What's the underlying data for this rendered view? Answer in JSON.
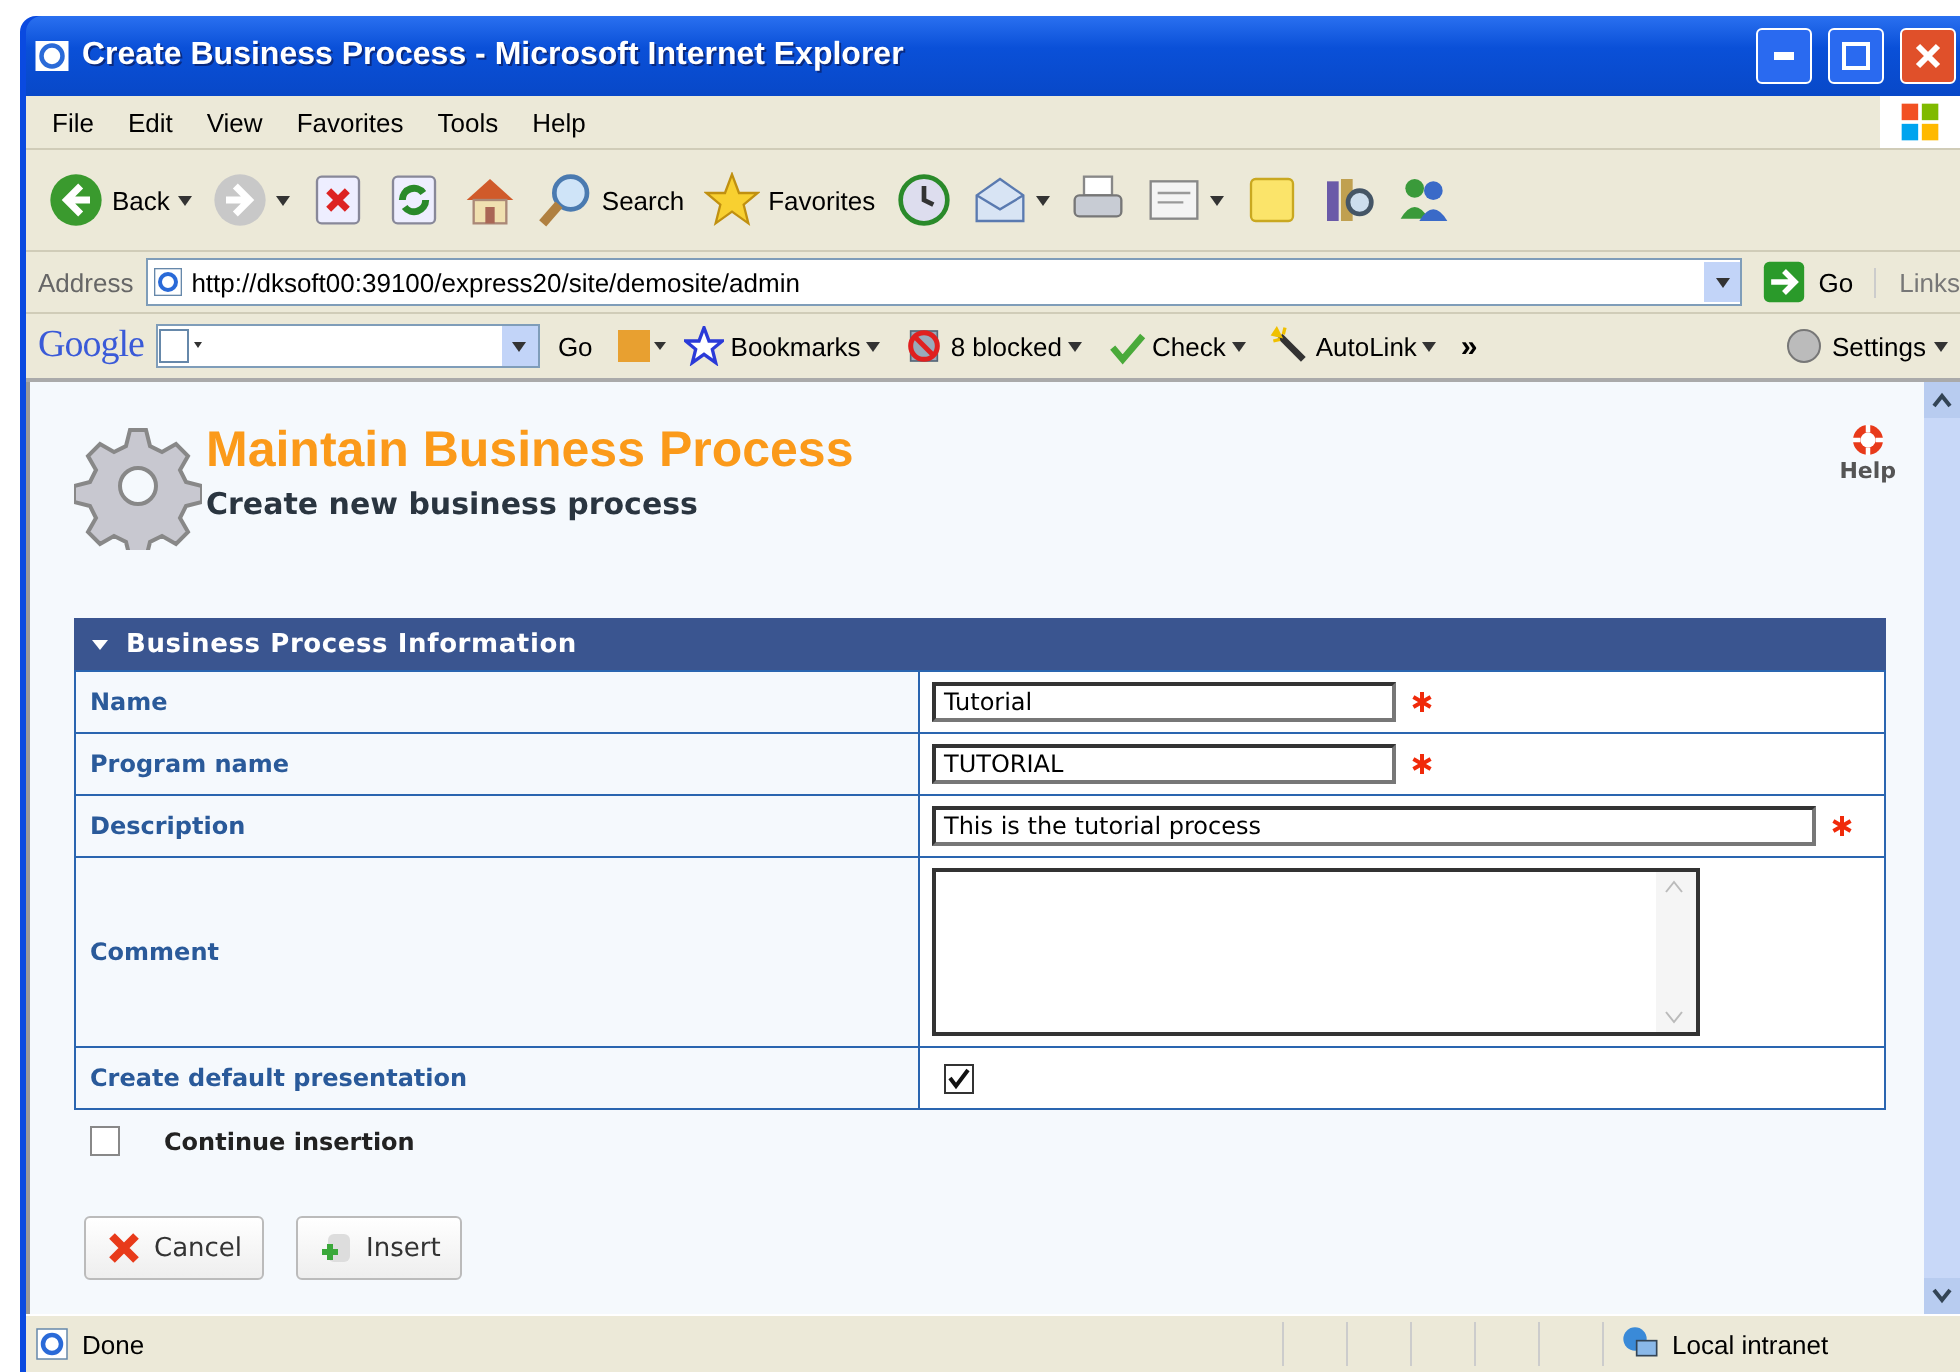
{
  "window": {
    "title": "Create Business Process - Microsoft Internet Explorer"
  },
  "menu": [
    "File",
    "Edit",
    "View",
    "Favorites",
    "Tools",
    "Help"
  ],
  "toolbar": [
    {
      "kind": "back",
      "label": "Back",
      "dropdown": true
    },
    {
      "kind": "forward",
      "dropdown": true
    },
    {
      "kind": "stop",
      "dropdown": false
    },
    {
      "kind": "refresh",
      "dropdown": false
    },
    {
      "kind": "home",
      "dropdown": false
    },
    {
      "kind": "search",
      "label": "Search",
      "dropdown": false
    },
    {
      "kind": "favorites",
      "label": "Favorites",
      "dropdown": false
    },
    {
      "kind": "history",
      "dropdown": false
    },
    {
      "kind": "mail",
      "dropdown": true
    },
    {
      "kind": "print",
      "dropdown": false
    },
    {
      "kind": "edit",
      "dropdown": true
    },
    {
      "kind": "note",
      "dropdown": false
    },
    {
      "kind": "research",
      "dropdown": false
    },
    {
      "kind": "messenger",
      "dropdown": false
    }
  ],
  "address": {
    "label": "Address",
    "url": "http://dksoft00:39100/express20/site/demosite/admin",
    "go": "Go",
    "links": "Links"
  },
  "google_bar": {
    "logo": "Google",
    "go": "Go",
    "items": [
      {
        "kind": "bookmarks",
        "label": "Bookmarks"
      },
      {
        "kind": "blocked",
        "label": "8 blocked"
      },
      {
        "kind": "check",
        "label": "Check"
      },
      {
        "kind": "autolink",
        "label": "AutoLink"
      }
    ],
    "more": "»",
    "settings": "Settings"
  },
  "page": {
    "title": "Maintain Business Process",
    "subtitle": "Create new business process",
    "help": "Help",
    "section": {
      "title": "Business Process Information",
      "expanded": true
    },
    "rows": [
      {
        "kind": "short_text",
        "label": "Name",
        "value": "Tutorial",
        "required": true
      },
      {
        "kind": "short_text",
        "label": "Program name",
        "value": "TUTORIAL",
        "required": true
      },
      {
        "kind": "long_text",
        "label": "Description",
        "value": "This is the tutorial process",
        "required": true
      },
      {
        "kind": "textarea",
        "label": "Comment",
        "required": false
      },
      {
        "kind": "checkbox",
        "label": "Create default presentation",
        "checked": true,
        "required": false
      }
    ],
    "continue": {
      "label": "Continue insertion",
      "checked": false
    },
    "buttons": [
      {
        "kind": "cancel",
        "label": "Cancel"
      },
      {
        "kind": "insert",
        "label": "Insert"
      }
    ]
  },
  "status_bar": {
    "text": "Done",
    "zone": "Local intranet"
  }
}
